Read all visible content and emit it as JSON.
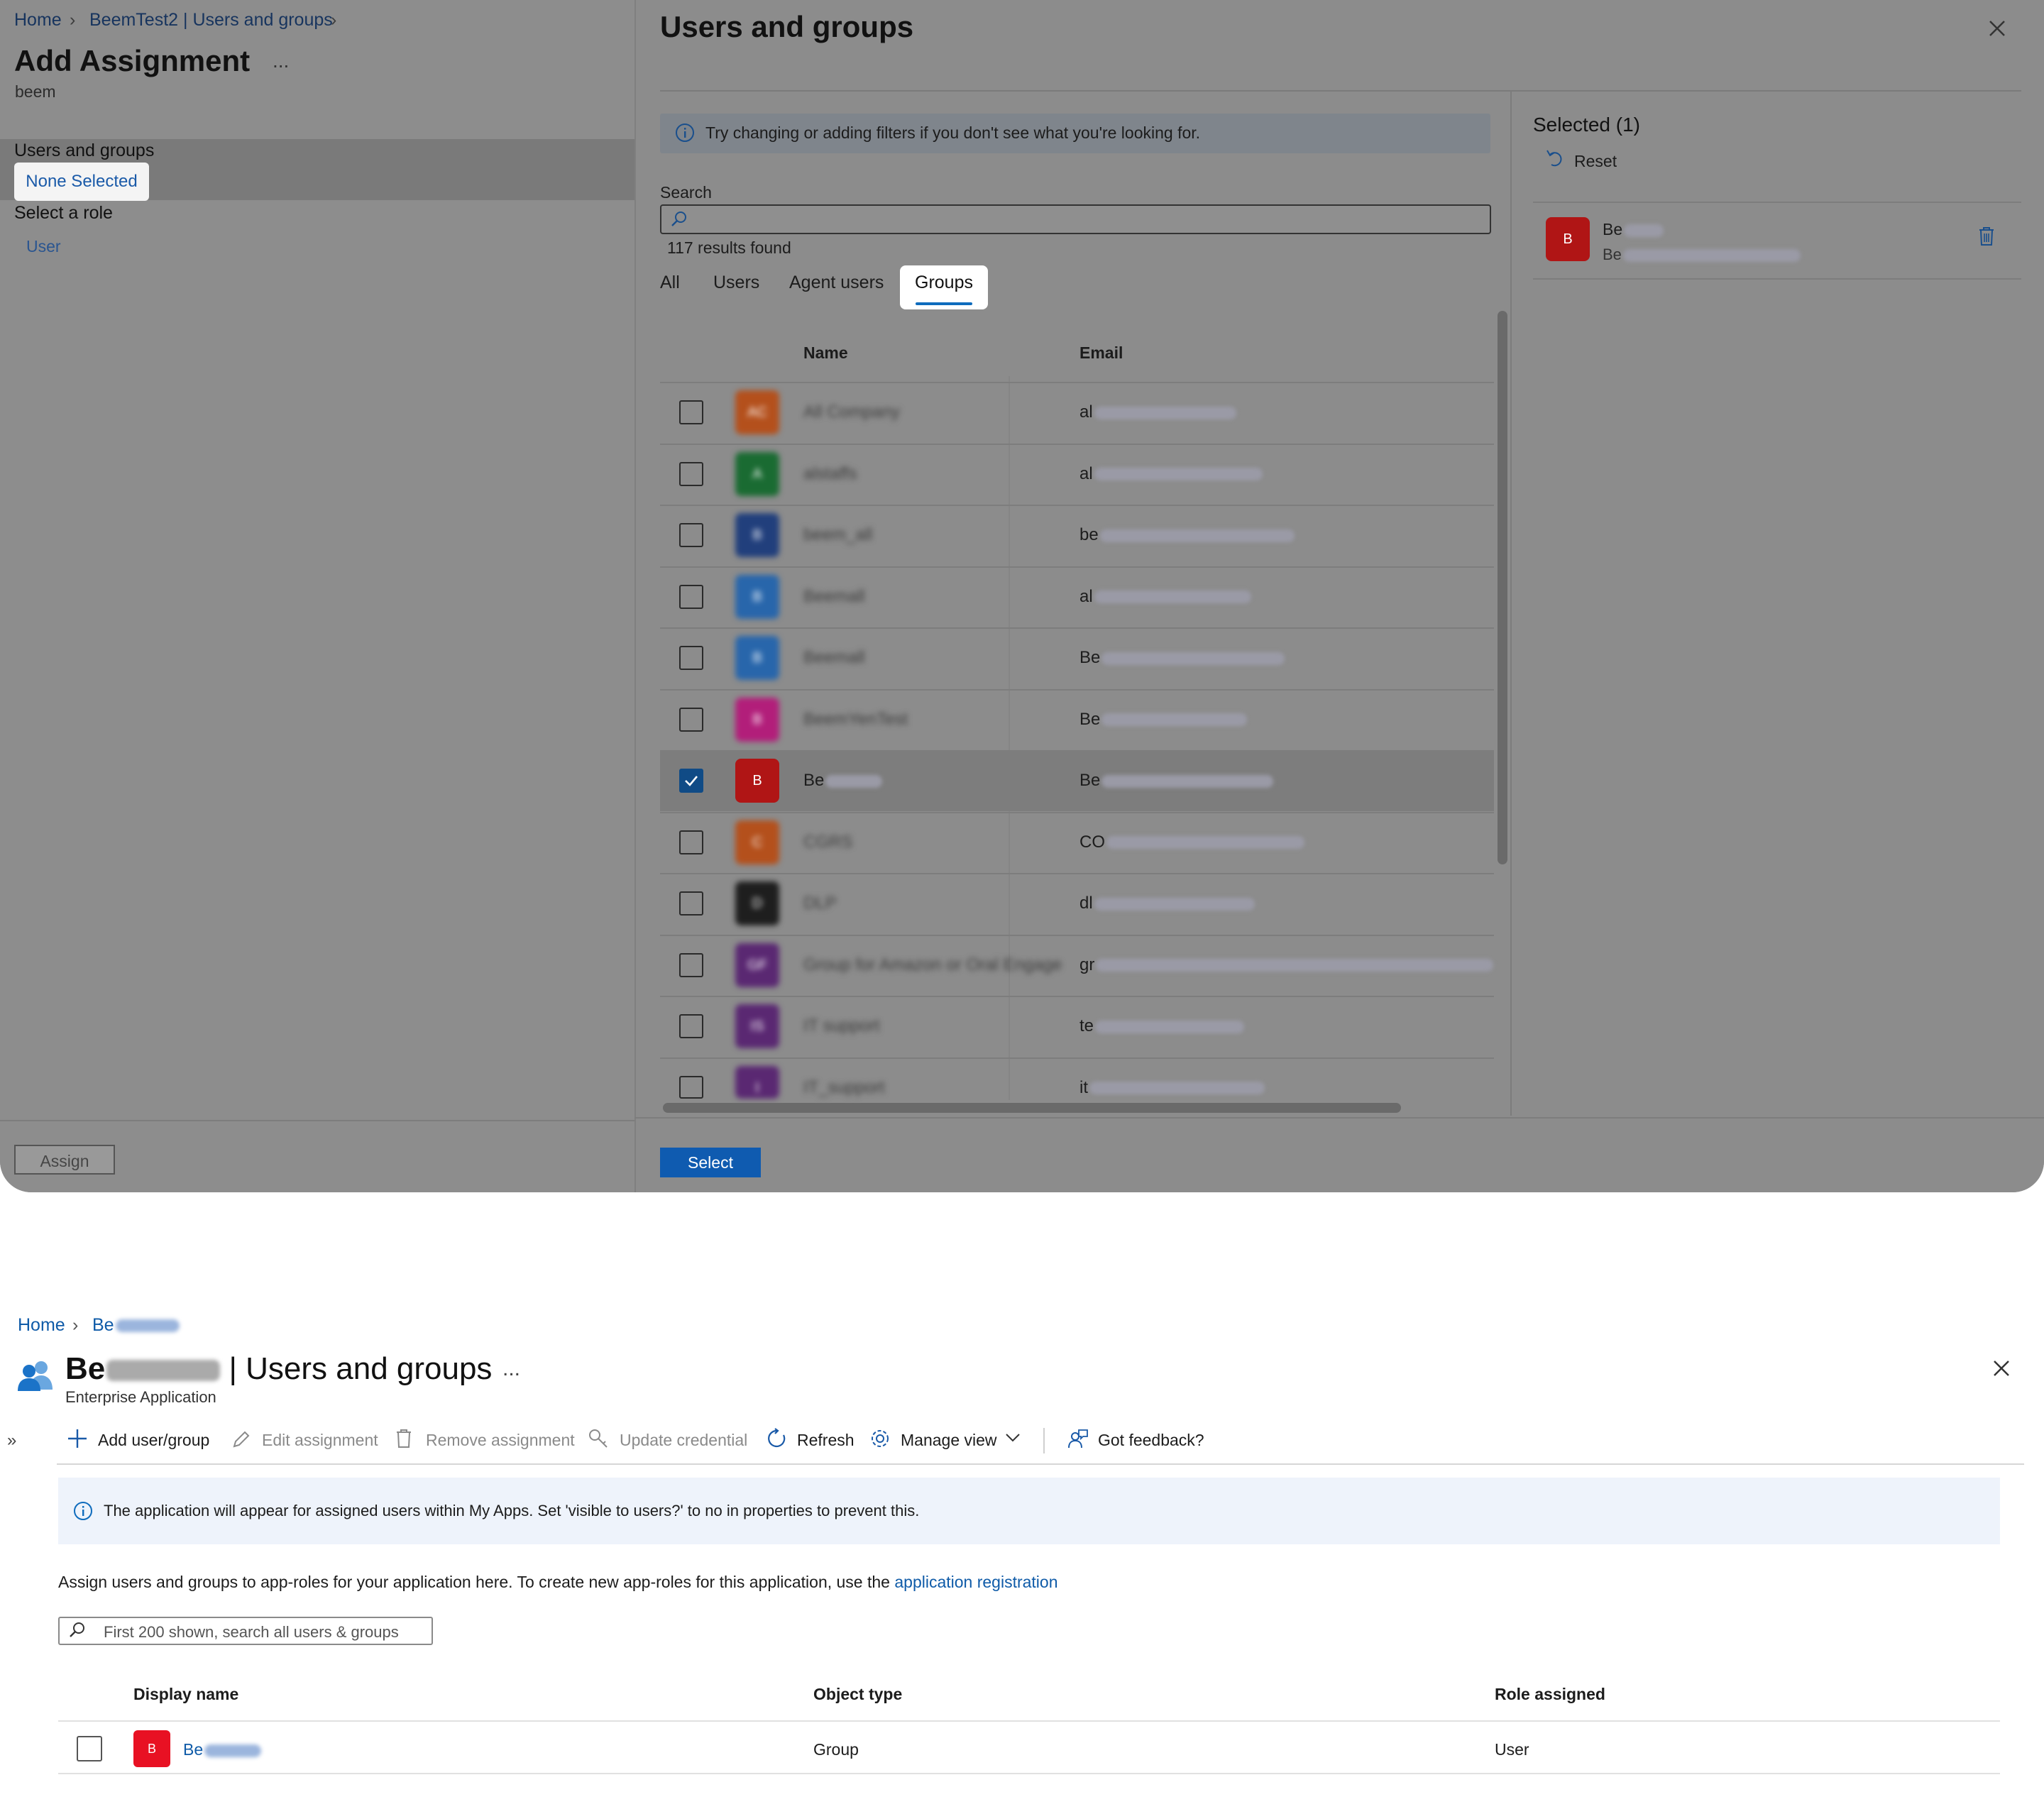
{
  "top": {
    "breadcrumb": [
      "Home",
      "BeemTest2 | Users and groups"
    ],
    "blade_title": "Add Assignment",
    "blade_subtitle": "beem",
    "more_label": "...",
    "users_groups_label": "Users and groups",
    "none_selected": "None Selected",
    "select_role_label": "Select a role",
    "role_value": "User",
    "assign_button": "Assign",
    "panel": {
      "title": "Users and groups",
      "info_text": "Try changing or adding filters if you don't see what you're looking for.",
      "search_label": "Search",
      "results_text": "117 results found",
      "tabs": [
        "All",
        "Users",
        "Agent users",
        "Groups"
      ],
      "active_tab": "Groups",
      "columns": {
        "name": "Name",
        "email": "Email"
      },
      "rows": [
        {
          "name": "All Company",
          "email_prefix": "al",
          "avatar": "AC",
          "color": "#b4501c",
          "checked": false
        },
        {
          "name": "alstaffs",
          "email_prefix": "al",
          "avatar": "A",
          "color": "#1a6b32",
          "checked": false
        },
        {
          "name": "beem_all",
          "email_prefix": "be",
          "avatar": "B",
          "color": "#213f7c",
          "checked": false
        },
        {
          "name": "Beemall",
          "email_prefix": "al",
          "avatar": "B",
          "color": "#2866ab",
          "checked": false
        },
        {
          "name": "Beemall",
          "email_prefix": "Be",
          "avatar": "B",
          "color": "#2866ab",
          "checked": false
        },
        {
          "name": "BeemYenTest",
          "email_prefix": "Be",
          "avatar": "B",
          "color": "#b21e7a",
          "checked": false
        },
        {
          "name": "Be",
          "email_prefix": "Be",
          "avatar": "B",
          "color": "#b01515",
          "checked": true
        },
        {
          "name": "CGRS",
          "email_prefix": "CO",
          "avatar": "C",
          "color": "#b4501c",
          "checked": false
        },
        {
          "name": "DLP",
          "email_prefix": "dl",
          "avatar": "D",
          "color": "#1e1e1e",
          "checked": false
        },
        {
          "name": "Group for Amazon or Oral Engage",
          "email_prefix": "gr",
          "avatar": "GF",
          "color": "#5a2872",
          "checked": false
        },
        {
          "name": "IT support",
          "email_prefix": "te",
          "avatar": "IS",
          "color": "#5a2872",
          "checked": false
        },
        {
          "name": "IT_support",
          "email_prefix": "it",
          "avatar": "I",
          "color": "#5a2872",
          "checked": false
        }
      ],
      "select_button": "Select",
      "selected_title": "Selected (1)",
      "reset_label": "Reset",
      "selected_item": {
        "name_prefix": "Be",
        "email_prefix": "Be",
        "avatar": "B"
      }
    }
  },
  "bottom": {
    "breadcrumb_home": "Home",
    "breadcrumb_app": "Be",
    "app_name_prefix": "Be",
    "title_suffix": "| Users and groups",
    "more_label": "...",
    "subtitle": "Enterprise Application",
    "collapse_label": "»",
    "toolbar": {
      "add": "Add user/group",
      "edit": "Edit assignment",
      "remove": "Remove assignment",
      "update": "Update credential",
      "refresh": "Refresh",
      "manage": "Manage view",
      "feedback": "Got feedback?"
    },
    "info_text": "The application will appear for assigned users within My Apps. Set 'visible to users?' to no in properties to prevent this.",
    "description": "Assign users and groups to app-roles for your application here. To create new app-roles for this application, use the ",
    "description_link": "application registration",
    "search_placeholder": "First 200 shown, search all users & groups",
    "columns": {
      "display_name": "Display name",
      "object_type": "Object type",
      "role": "Role assigned"
    },
    "row": {
      "name_prefix": "Be",
      "object_type": "Group",
      "role": "User",
      "avatar": "B"
    }
  },
  "colors": {
    "accent": "#0f6cbd",
    "link": "#0f5ba8",
    "selected_avatar": "#e81123"
  }
}
